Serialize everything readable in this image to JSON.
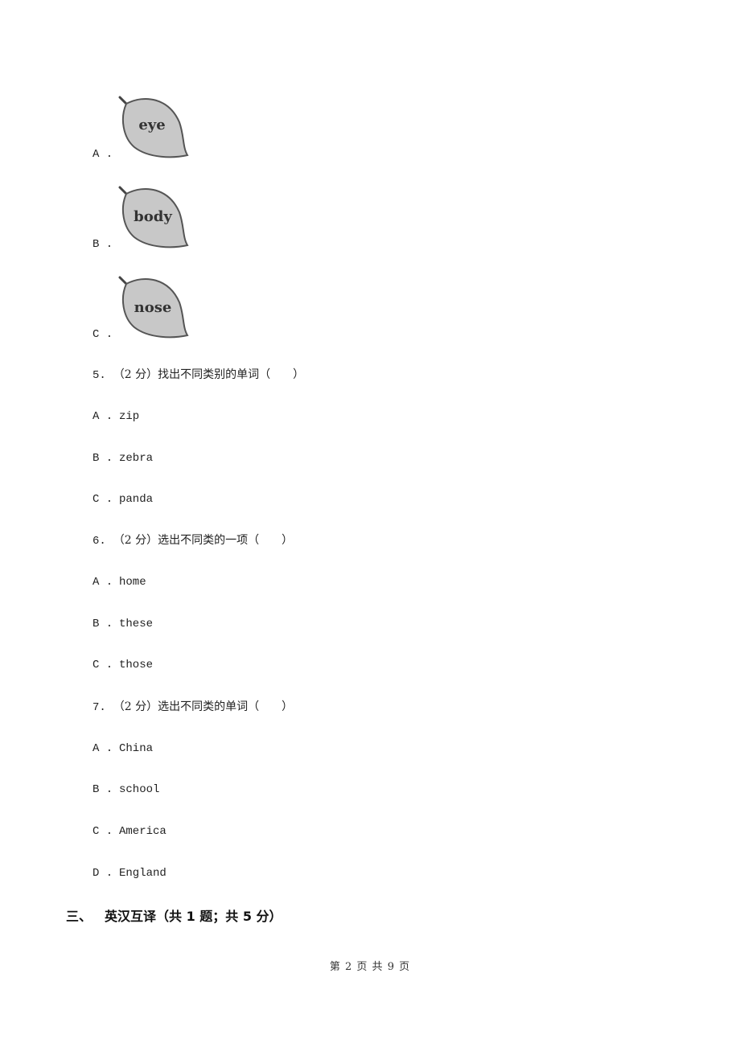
{
  "image_options": [
    {
      "letter": "A .",
      "word": "eye"
    },
    {
      "letter": "B .",
      "word": "body"
    },
    {
      "letter": "C .",
      "word": "nose"
    }
  ],
  "questions": [
    {
      "number": "5.",
      "prompt": "（2 分）找出不同类别的单词（　　）",
      "options": [
        {
          "letter": "A .",
          "text": "zip"
        },
        {
          "letter": "B .",
          "text": "zebra"
        },
        {
          "letter": "C .",
          "text": "panda"
        }
      ]
    },
    {
      "number": "6.",
      "prompt": "（2 分）选出不同类的一项（　　）",
      "options": [
        {
          "letter": "A .",
          "text": "home"
        },
        {
          "letter": "B .",
          "text": "these"
        },
        {
          "letter": "C .",
          "text": "those"
        }
      ]
    },
    {
      "number": "7.",
      "prompt": "（2 分）选出不同类的单词（　　）",
      "options": [
        {
          "letter": "A .",
          "text": "China"
        },
        {
          "letter": "B .",
          "text": "school"
        },
        {
          "letter": "C .",
          "text": "America"
        },
        {
          "letter": "D .",
          "text": "England"
        }
      ]
    }
  ],
  "section": {
    "number": "三、",
    "title": "英汉互译（共 1 题；共 5 分）"
  },
  "footer": {
    "page_label": "第 2 页 共 9 页"
  },
  "colors": {
    "leaf_fill": "#c8c8c8",
    "leaf_stroke": "#555555"
  }
}
